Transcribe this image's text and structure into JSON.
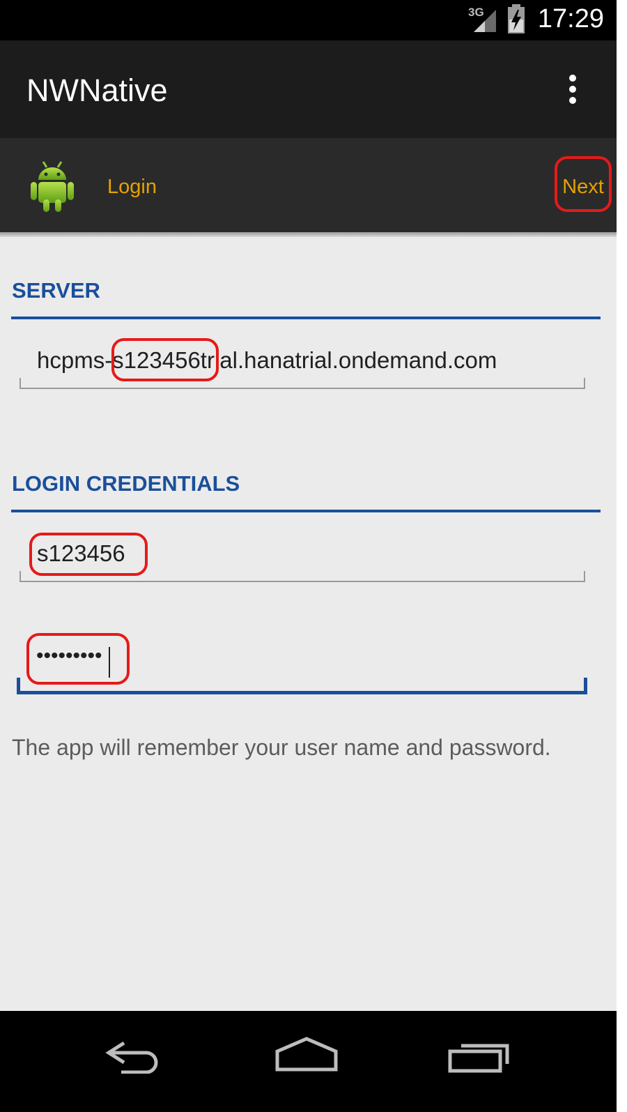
{
  "status_bar": {
    "time": "17:29",
    "network_label": "3G",
    "icons": [
      "signal-icon",
      "battery-charging-icon"
    ]
  },
  "action_bar": {
    "title": "NWNative",
    "overflow_icon": "overflow-menu-icon"
  },
  "sub_bar": {
    "logo_icon": "android-logo-icon",
    "tab_label": "Login",
    "next_label": "Next"
  },
  "server_section": {
    "header": "SERVER",
    "server_url": "hcpms-s123456trial.hanatrial.ondemand.com"
  },
  "credentials_section": {
    "header": "LOGIN CREDENTIALS",
    "username": "s123456",
    "password_masked": "•••••••••"
  },
  "note": "The app will remember your user name and password.",
  "nav_bar": {
    "icons": [
      "back-icon",
      "home-icon",
      "recents-icon"
    ]
  },
  "colors": {
    "accent": "#e6a200",
    "section_blue": "#1a4f9b",
    "highlight_red": "#e61a1a",
    "background": "#ebebeb"
  }
}
